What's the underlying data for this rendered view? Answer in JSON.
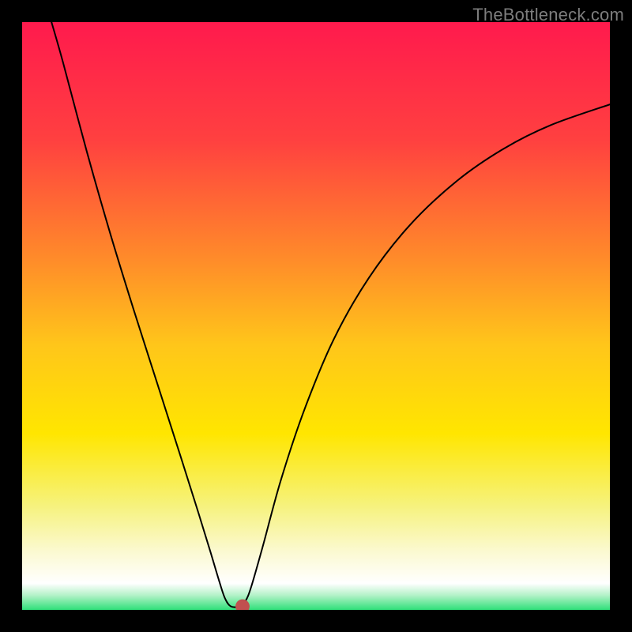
{
  "watermark": "TheBottleneck.com",
  "chart_data": {
    "type": "line",
    "title": "",
    "xlabel": "",
    "ylabel": "",
    "xlim": [
      0,
      100
    ],
    "ylim": [
      0,
      100
    ],
    "background": {
      "kind": "vertical-gradient",
      "stops": [
        {
          "pos": 0.0,
          "color": "#ff1a4d"
        },
        {
          "pos": 0.2,
          "color": "#ff4040"
        },
        {
          "pos": 0.4,
          "color": "#ff8a2a"
        },
        {
          "pos": 0.55,
          "color": "#ffc61a"
        },
        {
          "pos": 0.7,
          "color": "#ffe600"
        },
        {
          "pos": 0.82,
          "color": "#f6f27a"
        },
        {
          "pos": 0.9,
          "color": "#fbf9d0"
        },
        {
          "pos": 0.955,
          "color": "#ffffff"
        },
        {
          "pos": 0.975,
          "color": "#b4f2c8"
        },
        {
          "pos": 1.0,
          "color": "#2fe07a"
        }
      ]
    },
    "curve": {
      "color": "#000000",
      "width": 2,
      "points": [
        {
          "x": 5.0,
          "y": 100.0
        },
        {
          "x": 7.0,
          "y": 93.0
        },
        {
          "x": 11.0,
          "y": 78.0
        },
        {
          "x": 15.0,
          "y": 64.0
        },
        {
          "x": 19.0,
          "y": 51.0
        },
        {
          "x": 23.0,
          "y": 38.5
        },
        {
          "x": 27.0,
          "y": 26.0
        },
        {
          "x": 30.0,
          "y": 16.5
        },
        {
          "x": 32.0,
          "y": 10.0
        },
        {
          "x": 33.5,
          "y": 5.0
        },
        {
          "x": 34.5,
          "y": 2.0
        },
        {
          "x": 35.5,
          "y": 0.6
        },
        {
          "x": 37.0,
          "y": 0.6
        },
        {
          "x": 38.0,
          "y": 1.5
        },
        {
          "x": 39.0,
          "y": 4.0
        },
        {
          "x": 41.0,
          "y": 11.0
        },
        {
          "x": 44.0,
          "y": 22.0
        },
        {
          "x": 48.0,
          "y": 34.0
        },
        {
          "x": 53.0,
          "y": 46.0
        },
        {
          "x": 59.0,
          "y": 56.5
        },
        {
          "x": 66.0,
          "y": 65.5
        },
        {
          "x": 74.0,
          "y": 73.0
        },
        {
          "x": 82.0,
          "y": 78.5
        },
        {
          "x": 90.0,
          "y": 82.5
        },
        {
          "x": 100.0,
          "y": 86.0
        }
      ]
    },
    "marker": {
      "x": 37.5,
      "y": 0.6,
      "r": 1.2,
      "color": "#c1504f"
    }
  }
}
